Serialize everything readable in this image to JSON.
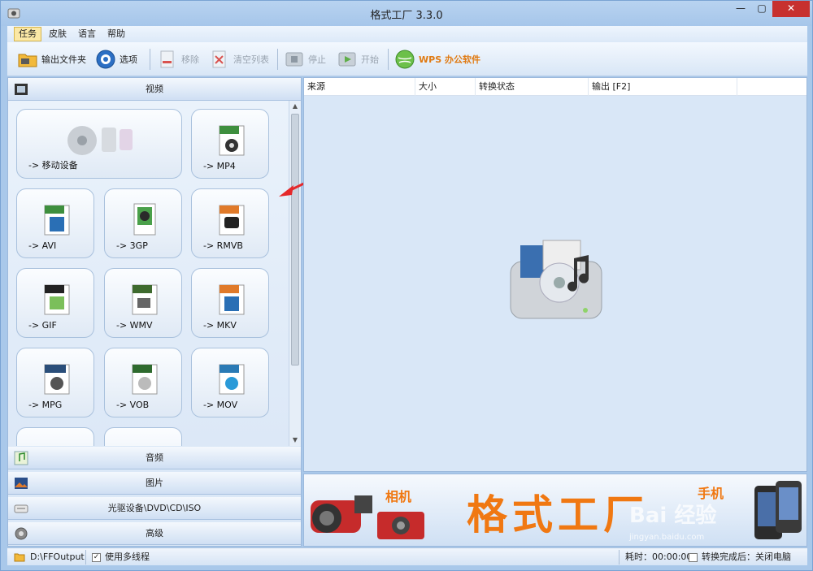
{
  "window": {
    "title": "格式工厂 3.3.0"
  },
  "menu": [
    "任务",
    "皮肤",
    "语言",
    "帮助"
  ],
  "toolbar": {
    "output_folder": "输出文件夹",
    "options": "选项",
    "remove": "移除",
    "clear_list": "清空列表",
    "stop": "停止",
    "start": "开始",
    "wps": "WPS 办公软件"
  },
  "categories": {
    "video": "视频",
    "audio": "音频",
    "image": "图片",
    "rom": "光驱设备\\DVD\\CD\\ISO",
    "advanced": "高级"
  },
  "tiles": [
    {
      "label": "-> 移动设备",
      "badge": ""
    },
    {
      "label": "-> MP4",
      "badge": "MP4"
    },
    {
      "label": "-> AVI",
      "badge": "AVI"
    },
    {
      "label": "-> 3GP",
      "badge": "3GP"
    },
    {
      "label": "-> RMVB",
      "badge": "RMVB"
    },
    {
      "label": "-> GIF",
      "badge": "GIF"
    },
    {
      "label": "-> WMV",
      "badge": "WMV"
    },
    {
      "label": "-> MKV",
      "badge": "MKV"
    },
    {
      "label": "-> MPG",
      "badge": "MPEG"
    },
    {
      "label": "-> VOB",
      "badge": "VOB"
    },
    {
      "label": "-> MOV",
      "badge": "MOV"
    }
  ],
  "columns": [
    "来源",
    "大小",
    "转换状态",
    "输出 [F2]"
  ],
  "banner": {
    "title": "格式工厂",
    "camera": "相机",
    "phone": "手机",
    "watermark": "Bai 经验",
    "watermark_url": "jingyan.baidu.com"
  },
  "status": {
    "output_path": "D:\\FFOutput",
    "multithread": "使用多线程",
    "elapsed": "耗时：00:00:00",
    "after_done": "转换完成后：关闭电脑"
  },
  "colors": {
    "accent": "#f07812",
    "close": "#c7312f",
    "panel": "#d9e7f7"
  }
}
